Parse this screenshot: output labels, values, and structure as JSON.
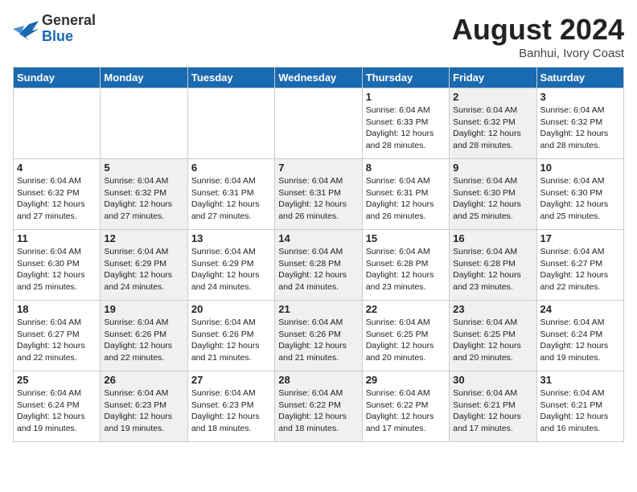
{
  "header": {
    "logo_line1": "General",
    "logo_line2": "Blue",
    "month_title": "August 2024",
    "location": "Banhui, Ivory Coast"
  },
  "days_of_week": [
    "Sunday",
    "Monday",
    "Tuesday",
    "Wednesday",
    "Thursday",
    "Friday",
    "Saturday"
  ],
  "weeks": [
    [
      {
        "day": "",
        "info": "",
        "shaded": false
      },
      {
        "day": "",
        "info": "",
        "shaded": false
      },
      {
        "day": "",
        "info": "",
        "shaded": false
      },
      {
        "day": "",
        "info": "",
        "shaded": false
      },
      {
        "day": "1",
        "info": "Sunrise: 6:04 AM\nSunset: 6:33 PM\nDaylight: 12 hours\nand 28 minutes.",
        "shaded": false
      },
      {
        "day": "2",
        "info": "Sunrise: 6:04 AM\nSunset: 6:32 PM\nDaylight: 12 hours\nand 28 minutes.",
        "shaded": true
      },
      {
        "day": "3",
        "info": "Sunrise: 6:04 AM\nSunset: 6:32 PM\nDaylight: 12 hours\nand 28 minutes.",
        "shaded": false
      }
    ],
    [
      {
        "day": "4",
        "info": "Sunrise: 6:04 AM\nSunset: 6:32 PM\nDaylight: 12 hours\nand 27 minutes.",
        "shaded": false
      },
      {
        "day": "5",
        "info": "Sunrise: 6:04 AM\nSunset: 6:32 PM\nDaylight: 12 hours\nand 27 minutes.",
        "shaded": true
      },
      {
        "day": "6",
        "info": "Sunrise: 6:04 AM\nSunset: 6:31 PM\nDaylight: 12 hours\nand 27 minutes.",
        "shaded": false
      },
      {
        "day": "7",
        "info": "Sunrise: 6:04 AM\nSunset: 6:31 PM\nDaylight: 12 hours\nand 26 minutes.",
        "shaded": true
      },
      {
        "day": "8",
        "info": "Sunrise: 6:04 AM\nSunset: 6:31 PM\nDaylight: 12 hours\nand 26 minutes.",
        "shaded": false
      },
      {
        "day": "9",
        "info": "Sunrise: 6:04 AM\nSunset: 6:30 PM\nDaylight: 12 hours\nand 25 minutes.",
        "shaded": true
      },
      {
        "day": "10",
        "info": "Sunrise: 6:04 AM\nSunset: 6:30 PM\nDaylight: 12 hours\nand 25 minutes.",
        "shaded": false
      }
    ],
    [
      {
        "day": "11",
        "info": "Sunrise: 6:04 AM\nSunset: 6:30 PM\nDaylight: 12 hours\nand 25 minutes.",
        "shaded": false
      },
      {
        "day": "12",
        "info": "Sunrise: 6:04 AM\nSunset: 6:29 PM\nDaylight: 12 hours\nand 24 minutes.",
        "shaded": true
      },
      {
        "day": "13",
        "info": "Sunrise: 6:04 AM\nSunset: 6:29 PM\nDaylight: 12 hours\nand 24 minutes.",
        "shaded": false
      },
      {
        "day": "14",
        "info": "Sunrise: 6:04 AM\nSunset: 6:28 PM\nDaylight: 12 hours\nand 24 minutes.",
        "shaded": true
      },
      {
        "day": "15",
        "info": "Sunrise: 6:04 AM\nSunset: 6:28 PM\nDaylight: 12 hours\nand 23 minutes.",
        "shaded": false
      },
      {
        "day": "16",
        "info": "Sunrise: 6:04 AM\nSunset: 6:28 PM\nDaylight: 12 hours\nand 23 minutes.",
        "shaded": true
      },
      {
        "day": "17",
        "info": "Sunrise: 6:04 AM\nSunset: 6:27 PM\nDaylight: 12 hours\nand 22 minutes.",
        "shaded": false
      }
    ],
    [
      {
        "day": "18",
        "info": "Sunrise: 6:04 AM\nSunset: 6:27 PM\nDaylight: 12 hours\nand 22 minutes.",
        "shaded": false
      },
      {
        "day": "19",
        "info": "Sunrise: 6:04 AM\nSunset: 6:26 PM\nDaylight: 12 hours\nand 22 minutes.",
        "shaded": true
      },
      {
        "day": "20",
        "info": "Sunrise: 6:04 AM\nSunset: 6:26 PM\nDaylight: 12 hours\nand 21 minutes.",
        "shaded": false
      },
      {
        "day": "21",
        "info": "Sunrise: 6:04 AM\nSunset: 6:26 PM\nDaylight: 12 hours\nand 21 minutes.",
        "shaded": true
      },
      {
        "day": "22",
        "info": "Sunrise: 6:04 AM\nSunset: 6:25 PM\nDaylight: 12 hours\nand 20 minutes.",
        "shaded": false
      },
      {
        "day": "23",
        "info": "Sunrise: 6:04 AM\nSunset: 6:25 PM\nDaylight: 12 hours\nand 20 minutes.",
        "shaded": true
      },
      {
        "day": "24",
        "info": "Sunrise: 6:04 AM\nSunset: 6:24 PM\nDaylight: 12 hours\nand 19 minutes.",
        "shaded": false
      }
    ],
    [
      {
        "day": "25",
        "info": "Sunrise: 6:04 AM\nSunset: 6:24 PM\nDaylight: 12 hours\nand 19 minutes.",
        "shaded": false
      },
      {
        "day": "26",
        "info": "Sunrise: 6:04 AM\nSunset: 6:23 PM\nDaylight: 12 hours\nand 19 minutes.",
        "shaded": true
      },
      {
        "day": "27",
        "info": "Sunrise: 6:04 AM\nSunset: 6:23 PM\nDaylight: 12 hours\nand 18 minutes.",
        "shaded": false
      },
      {
        "day": "28",
        "info": "Sunrise: 6:04 AM\nSunset: 6:22 PM\nDaylight: 12 hours\nand 18 minutes.",
        "shaded": true
      },
      {
        "day": "29",
        "info": "Sunrise: 6:04 AM\nSunset: 6:22 PM\nDaylight: 12 hours\nand 17 minutes.",
        "shaded": false
      },
      {
        "day": "30",
        "info": "Sunrise: 6:04 AM\nSunset: 6:21 PM\nDaylight: 12 hours\nand 17 minutes.",
        "shaded": true
      },
      {
        "day": "31",
        "info": "Sunrise: 6:04 AM\nSunset: 6:21 PM\nDaylight: 12 hours\nand 16 minutes.",
        "shaded": false
      }
    ]
  ]
}
